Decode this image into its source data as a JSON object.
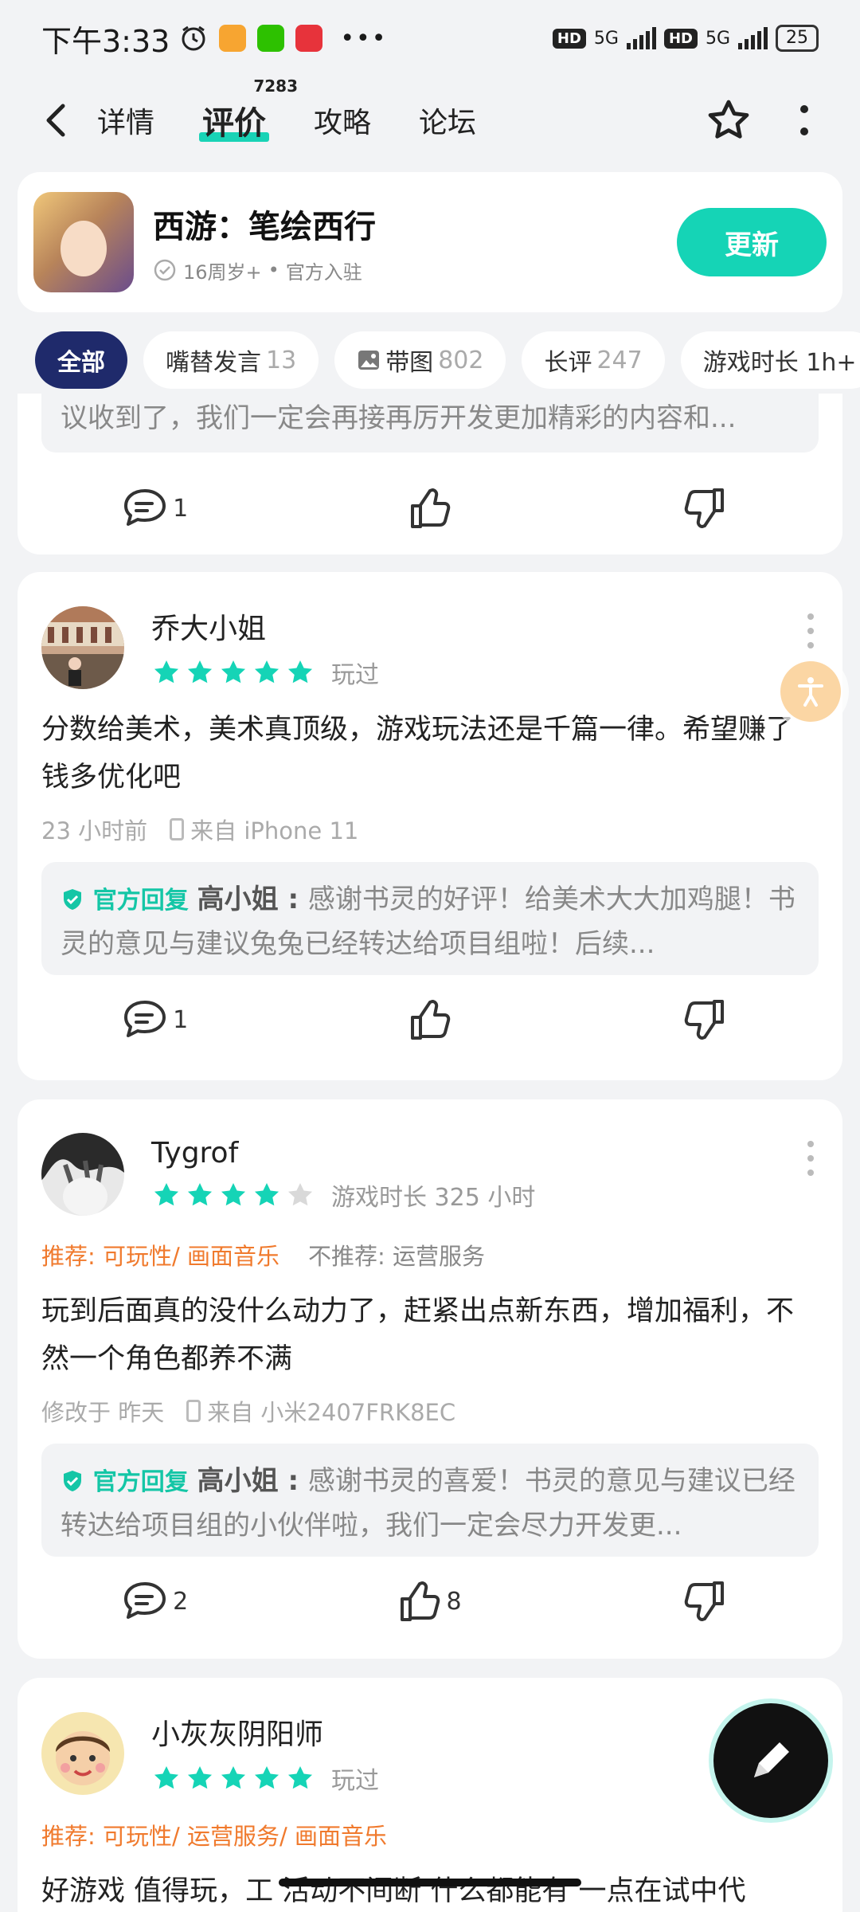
{
  "status_bar": {
    "time": "下午3:33",
    "net1": "5G",
    "net2": "5G",
    "battery": "25"
  },
  "nav": {
    "tabs": [
      {
        "label": "详情"
      },
      {
        "label": "评价",
        "badge": "7283"
      },
      {
        "label": "攻略"
      },
      {
        "label": "论坛"
      }
    ]
  },
  "game": {
    "title": "西游：笔绘西行",
    "age": "16周岁+",
    "official": "官方入驻",
    "update_label": "更新"
  },
  "filters": [
    {
      "label": "全部",
      "count": ""
    },
    {
      "label": "嘴替发言",
      "count": "13"
    },
    {
      "label": "带图",
      "count": "802"
    },
    {
      "label": "长评",
      "count": "247"
    },
    {
      "label": "游戏时长 1h+",
      "count": ""
    }
  ],
  "colors": {
    "accent": "#15d4b6",
    "chip_active": "#1f2a6b",
    "star_on": "#15d4b6",
    "star_off": "#d9d9d9",
    "recommend": "#f07a2d"
  },
  "review0": {
    "reply_text": "议收到了，我们一定会再接再厉开发更加精彩的内容和...",
    "comments": "1"
  },
  "review1": {
    "name": "乔大小姐",
    "stars": 5,
    "status": "玩过",
    "text": "分数给美术，美术真顶级，游戏玩法还是千篇一律。希望赚了钱多优化吧",
    "time": "23 小时前",
    "device": "来自 iPhone 11",
    "reply_tag": "官方回复",
    "reply_who": "高小姐 : ",
    "reply_text": "感谢书灵的好评！给美术大大加鸡腿！书灵的意见与建议兔兔已经转达给项目组啦！后续...",
    "comments": "1"
  },
  "review2": {
    "name": "Tygrof",
    "stars": 4,
    "status": "游戏时长 325 小时",
    "recommend": "推荐: 可玩性/ 画面音乐",
    "not_recommend": "不推荐: 运营服务",
    "text": "玩到后面真的没什么动力了，赶紧出点新东西，增加福利，不然一个角色都养不满",
    "time": "修改于 昨天",
    "device": "来自 小米2407FRK8EC",
    "reply_tag": "官方回复",
    "reply_who": "高小姐 : ",
    "reply_text": "感谢书灵的喜爱！书灵的意见与建议已经转达给项目组的小伙伴啦，我们一定会尽力开发更...",
    "comments": "2",
    "likes": "8"
  },
  "review3": {
    "name": "小灰灰阴阳师",
    "stars": 5,
    "status": "玩过",
    "recommend": "推荐: 可玩性/ 运营服务/ 画面音乐",
    "text": "好游戏 值得玩，工 活动不间断 什么都能有 一点在试中代"
  }
}
